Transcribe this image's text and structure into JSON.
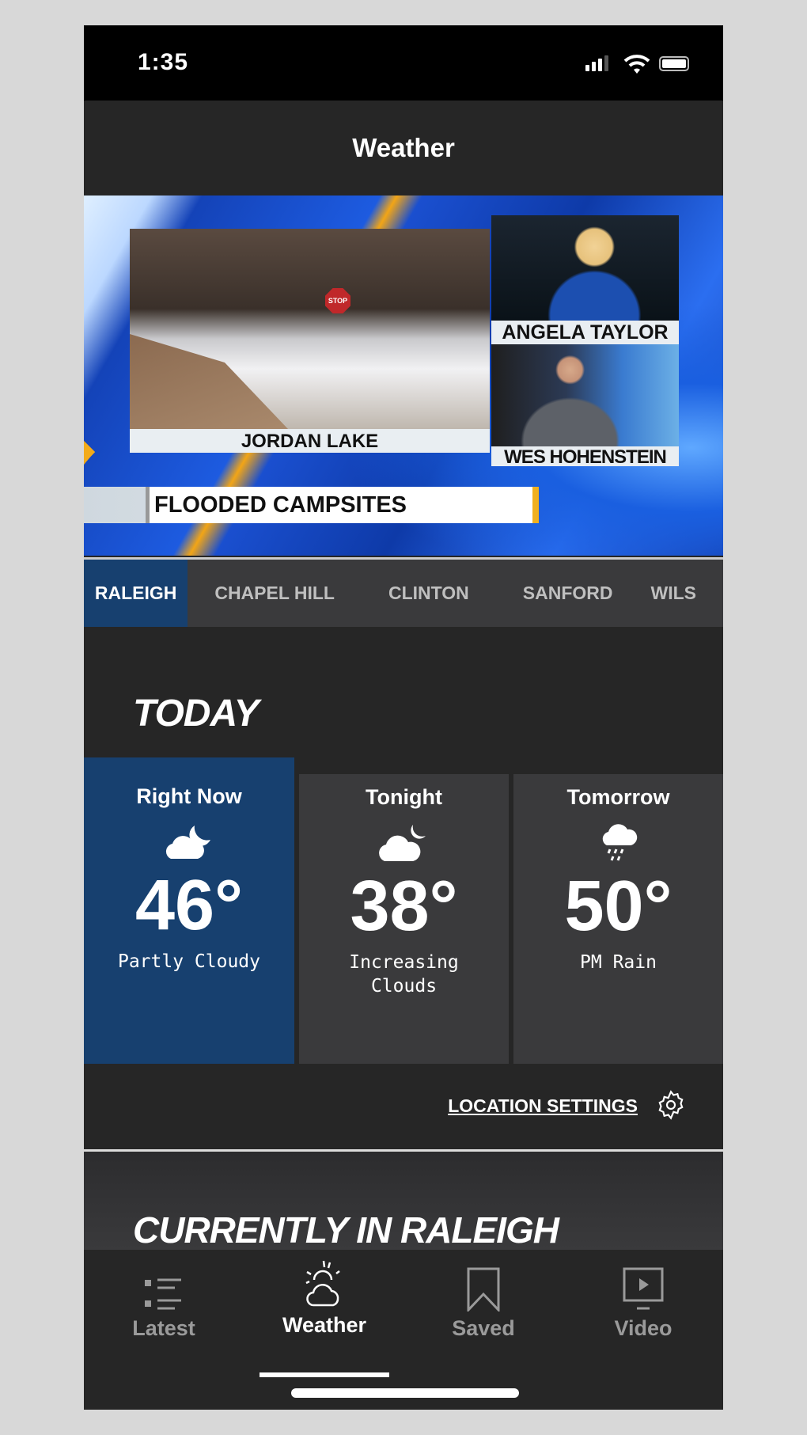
{
  "status_bar": {
    "time": "1:35"
  },
  "header": {
    "title": "Weather"
  },
  "video": {
    "main_caption": "JORDAN LAKE",
    "stop_sign": "STOP",
    "anchor1": "ANGELA TAYLOR",
    "anchor2": "WES HOHENSTEIN",
    "headline": "FLOODED CAMPSITES"
  },
  "location_tabs": [
    {
      "label": "RALEIGH",
      "active": true
    },
    {
      "label": "CHAPEL HILL"
    },
    {
      "label": "CLINTON"
    },
    {
      "label": "SANFORD"
    },
    {
      "label": "WILS"
    }
  ],
  "today": {
    "title": "TODAY",
    "cards": [
      {
        "label": "Right Now",
        "icon": "partly-cloudy-night-icon",
        "temp": "46°",
        "condition": "Partly Cloudy"
      },
      {
        "label": "Tonight",
        "icon": "cloud-moon-icon",
        "temp": "38°",
        "condition": "Increasing Clouds"
      },
      {
        "label": "Tomorrow",
        "icon": "rain-cloud-icon",
        "temp": "50°",
        "condition": "PM Rain"
      }
    ]
  },
  "location_settings": {
    "label": "LOCATION SETTINGS",
    "icon": "gear-icon"
  },
  "currently": {
    "title": "CURRENTLY IN RALEIGH"
  },
  "bottom_nav": [
    {
      "label": "Latest",
      "icon": "list-icon"
    },
    {
      "label": "Weather",
      "icon": "weather-icon",
      "active": true
    },
    {
      "label": "Saved",
      "icon": "bookmark-icon"
    },
    {
      "label": "Video",
      "icon": "video-icon"
    }
  ],
  "colors": {
    "accent": "#17406f",
    "background": "#262626",
    "card": "#3a3a3c"
  }
}
